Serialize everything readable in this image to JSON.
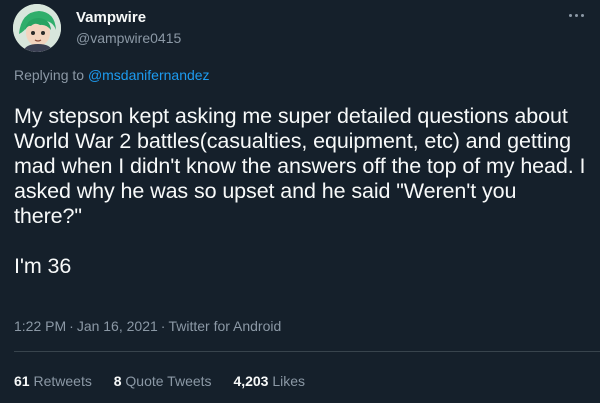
{
  "author": {
    "display_name": "Vampwire",
    "handle": "@vampwire0415",
    "avatar_icon": "anime-avatar"
  },
  "reply": {
    "prefix": "Replying to",
    "mention": "@msdanifernandez"
  },
  "tweet": {
    "text": "My stepson kept asking me super detailed questions about World War 2 battles(casualties, equipment, etc) and getting mad when I didn't know the answers off the top of my head. I asked why he was so upset and he said \"Weren't you there?\"\n\nI'm 36"
  },
  "meta": {
    "time": "1:22 PM",
    "date": "Jan 16, 2021",
    "source": "Twitter for Android",
    "separator": "·"
  },
  "stats": {
    "retweets_count": "61",
    "retweets_label": "Retweets",
    "quotes_count": "8",
    "quotes_label": "Quote Tweets",
    "likes_count": "4,203",
    "likes_label": "Likes"
  },
  "colors": {
    "background": "#15202b",
    "text": "#f7f9f9",
    "secondary": "#8b98a5",
    "accent": "#1d9bf0",
    "divider": "#38444d"
  }
}
